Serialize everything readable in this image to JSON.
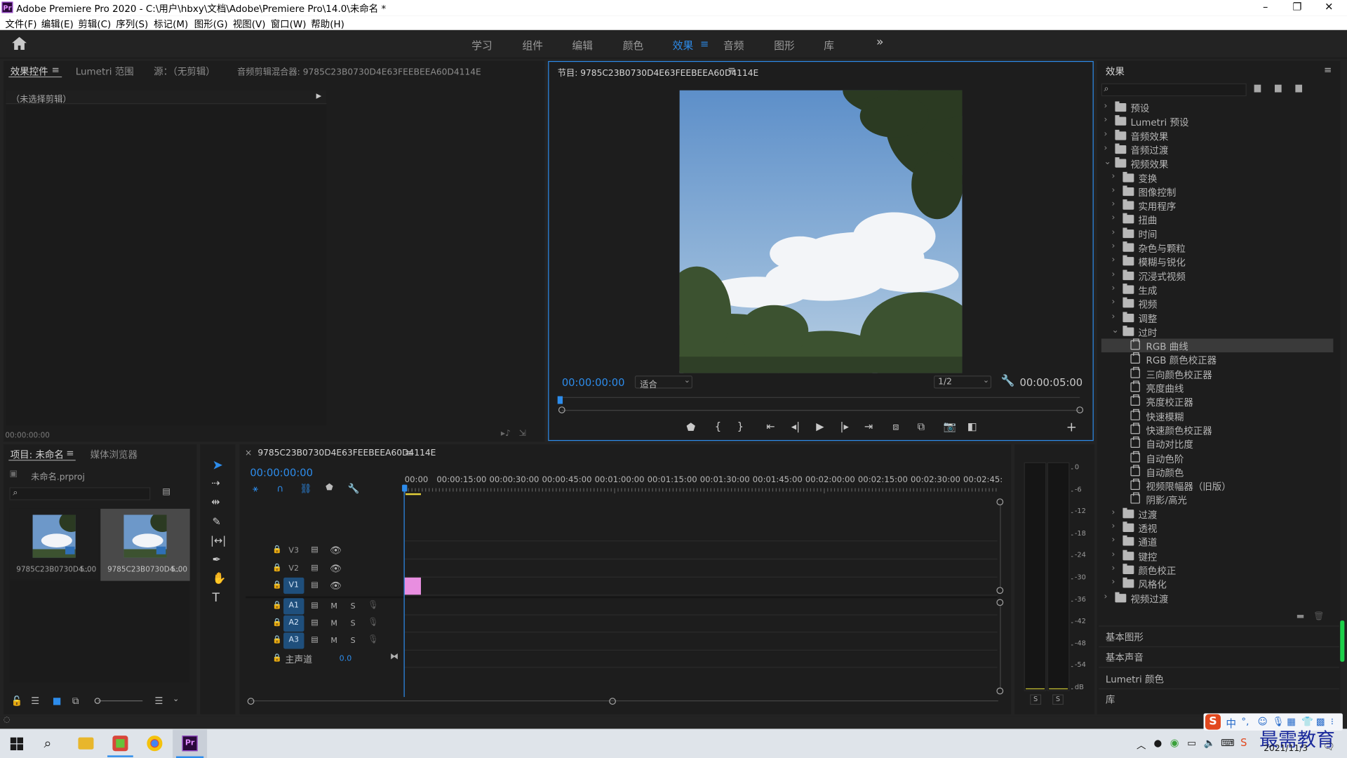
{
  "app": {
    "title": "Adobe Premiere Pro 2020 - C:\\用户\\hbxy\\文档\\Adobe\\Premiere Pro\\14.0\\未命名 *",
    "logo": "Pr"
  },
  "menu": [
    "文件(F)",
    "编辑(E)",
    "剪辑(C)",
    "序列(S)",
    "标记(M)",
    "图形(G)",
    "视图(V)",
    "窗口(W)",
    "帮助(H)"
  ],
  "workspaces": {
    "items": [
      "学习",
      "组件",
      "编辑",
      "颜色",
      "效果",
      "音频",
      "图形",
      "库"
    ],
    "active": "效果",
    "more": "»"
  },
  "source_panel": {
    "tabs": [
      "效果控件",
      "Lumetri 范围",
      "源：（无剪辑）",
      "音频剪辑混合器: 9785C23B0730D4E63FEEBEEA60D4114E"
    ],
    "no_clip": "（未选择剪辑）",
    "timecode": "00:00:00:00"
  },
  "program_monitor": {
    "title": "节目: 9785C23B0730D4E63FEEBEEA60D4114E",
    "timecode": "00:00:00:00",
    "fit": "适合",
    "resolution": "1/2",
    "duration": "00:00:05:00"
  },
  "effects_panel": {
    "title": "效果",
    "search_placeholder": "",
    "tree": [
      {
        "label": "预设",
        "level": 0,
        "kind": "folder",
        "arrow": "›"
      },
      {
        "label": "Lumetri 预设",
        "level": 0,
        "kind": "folder",
        "arrow": "›"
      },
      {
        "label": "音频效果",
        "level": 0,
        "kind": "folder",
        "arrow": "›"
      },
      {
        "label": "音频过渡",
        "level": 0,
        "kind": "folder",
        "arrow": "›"
      },
      {
        "label": "视频效果",
        "level": 0,
        "kind": "folder",
        "arrow": "⌄"
      },
      {
        "label": "变换",
        "level": 1,
        "kind": "folder",
        "arrow": "›"
      },
      {
        "label": "图像控制",
        "level": 1,
        "kind": "folder",
        "arrow": "›"
      },
      {
        "label": "实用程序",
        "level": 1,
        "kind": "folder",
        "arrow": "›"
      },
      {
        "label": "扭曲",
        "level": 1,
        "kind": "folder",
        "arrow": "›"
      },
      {
        "label": "时间",
        "level": 1,
        "kind": "folder",
        "arrow": "›"
      },
      {
        "label": "杂色与颗粒",
        "level": 1,
        "kind": "folder",
        "arrow": "›"
      },
      {
        "label": "模糊与锐化",
        "level": 1,
        "kind": "folder",
        "arrow": "›"
      },
      {
        "label": "沉浸式视频",
        "level": 1,
        "kind": "folder",
        "arrow": "›"
      },
      {
        "label": "生成",
        "level": 1,
        "kind": "folder",
        "arrow": "›"
      },
      {
        "label": "视频",
        "level": 1,
        "kind": "folder",
        "arrow": "›"
      },
      {
        "label": "调整",
        "level": 1,
        "kind": "folder",
        "arrow": "›"
      },
      {
        "label": "过时",
        "level": 1,
        "kind": "folder",
        "arrow": "⌄"
      },
      {
        "label": "RGB 曲线",
        "level": 2,
        "kind": "effect",
        "arrow": "",
        "selected": true
      },
      {
        "label": "RGB 颜色校正器",
        "level": 2,
        "kind": "effect",
        "arrow": ""
      },
      {
        "label": "三向颜色校正器",
        "level": 2,
        "kind": "effect",
        "arrow": ""
      },
      {
        "label": "亮度曲线",
        "level": 2,
        "kind": "effect",
        "arrow": ""
      },
      {
        "label": "亮度校正器",
        "level": 2,
        "kind": "effect",
        "arrow": ""
      },
      {
        "label": "快速模糊",
        "level": 2,
        "kind": "effect",
        "arrow": ""
      },
      {
        "label": "快速颜色校正器",
        "level": 2,
        "kind": "effect",
        "arrow": ""
      },
      {
        "label": "自动对比度",
        "level": 2,
        "kind": "effect",
        "arrow": ""
      },
      {
        "label": "自动色阶",
        "level": 2,
        "kind": "effect",
        "arrow": ""
      },
      {
        "label": "自动颜色",
        "level": 2,
        "kind": "effect",
        "arrow": ""
      },
      {
        "label": "视频限幅器（旧版）",
        "level": 2,
        "kind": "effect",
        "arrow": ""
      },
      {
        "label": "阴影/高光",
        "level": 2,
        "kind": "effect",
        "arrow": ""
      },
      {
        "label": "过渡",
        "level": 1,
        "kind": "folder",
        "arrow": "›"
      },
      {
        "label": "透视",
        "level": 1,
        "kind": "folder",
        "arrow": "›"
      },
      {
        "label": "通道",
        "level": 1,
        "kind": "folder",
        "arrow": "›"
      },
      {
        "label": "键控",
        "level": 1,
        "kind": "folder",
        "arrow": "›"
      },
      {
        "label": "颜色校正",
        "level": 1,
        "kind": "folder",
        "arrow": "›"
      },
      {
        "label": "风格化",
        "level": 1,
        "kind": "folder",
        "arrow": "›"
      },
      {
        "label": "视频过渡",
        "level": 0,
        "kind": "folder",
        "arrow": "›"
      }
    ],
    "side_panels": [
      "基本图形",
      "基本声音",
      "Lumetri 颜色",
      "库"
    ]
  },
  "project_panel": {
    "tabs": [
      "项目: 未命名",
      "媒体浏览器"
    ],
    "file": "未命名.prproj",
    "items": [
      {
        "name": "9785C23B0730D4...",
        "duration": "5:00"
      },
      {
        "name": "9785C23B0730D4...",
        "duration": "5:00"
      }
    ]
  },
  "timeline": {
    "title": "9785C23B0730D4E63FEEBEEA60D4114E",
    "close": "×",
    "timecode": "00:00:00:00",
    "ruler": [
      "00:00",
      "00:00:15:00",
      "00:00:30:00",
      "00:00:45:00",
      "00:01:00:00",
      "00:01:15:00",
      "00:01:30:00",
      "00:01:45:00",
      "00:02:00:00",
      "00:02:15:00",
      "00:02:30:00",
      "00:02:45:"
    ],
    "video_tracks": [
      "V3",
      "V2",
      "V1"
    ],
    "audio_tracks": [
      "A1",
      "A2",
      "A3"
    ],
    "track_m": "M",
    "track_s": "S",
    "master": {
      "label": "主声道",
      "value": "0.0"
    }
  },
  "audio_meter": {
    "scale": [
      "0",
      "-6",
      "-12",
      "-18",
      "-24",
      "-30",
      "-36",
      "-42",
      "-48",
      "-54",
      "dB"
    ],
    "solo": [
      "S",
      "S"
    ]
  },
  "taskbar": {
    "ime": "中",
    "date": "2021/11/3",
    "watermark": "最需教育"
  },
  "colors": {
    "accent": "#2d8ceb",
    "panel": "#1d1d1d",
    "track_btn": "#1f4f7c",
    "clip": "#e88ee0",
    "playhead": "#2d8ceb"
  }
}
